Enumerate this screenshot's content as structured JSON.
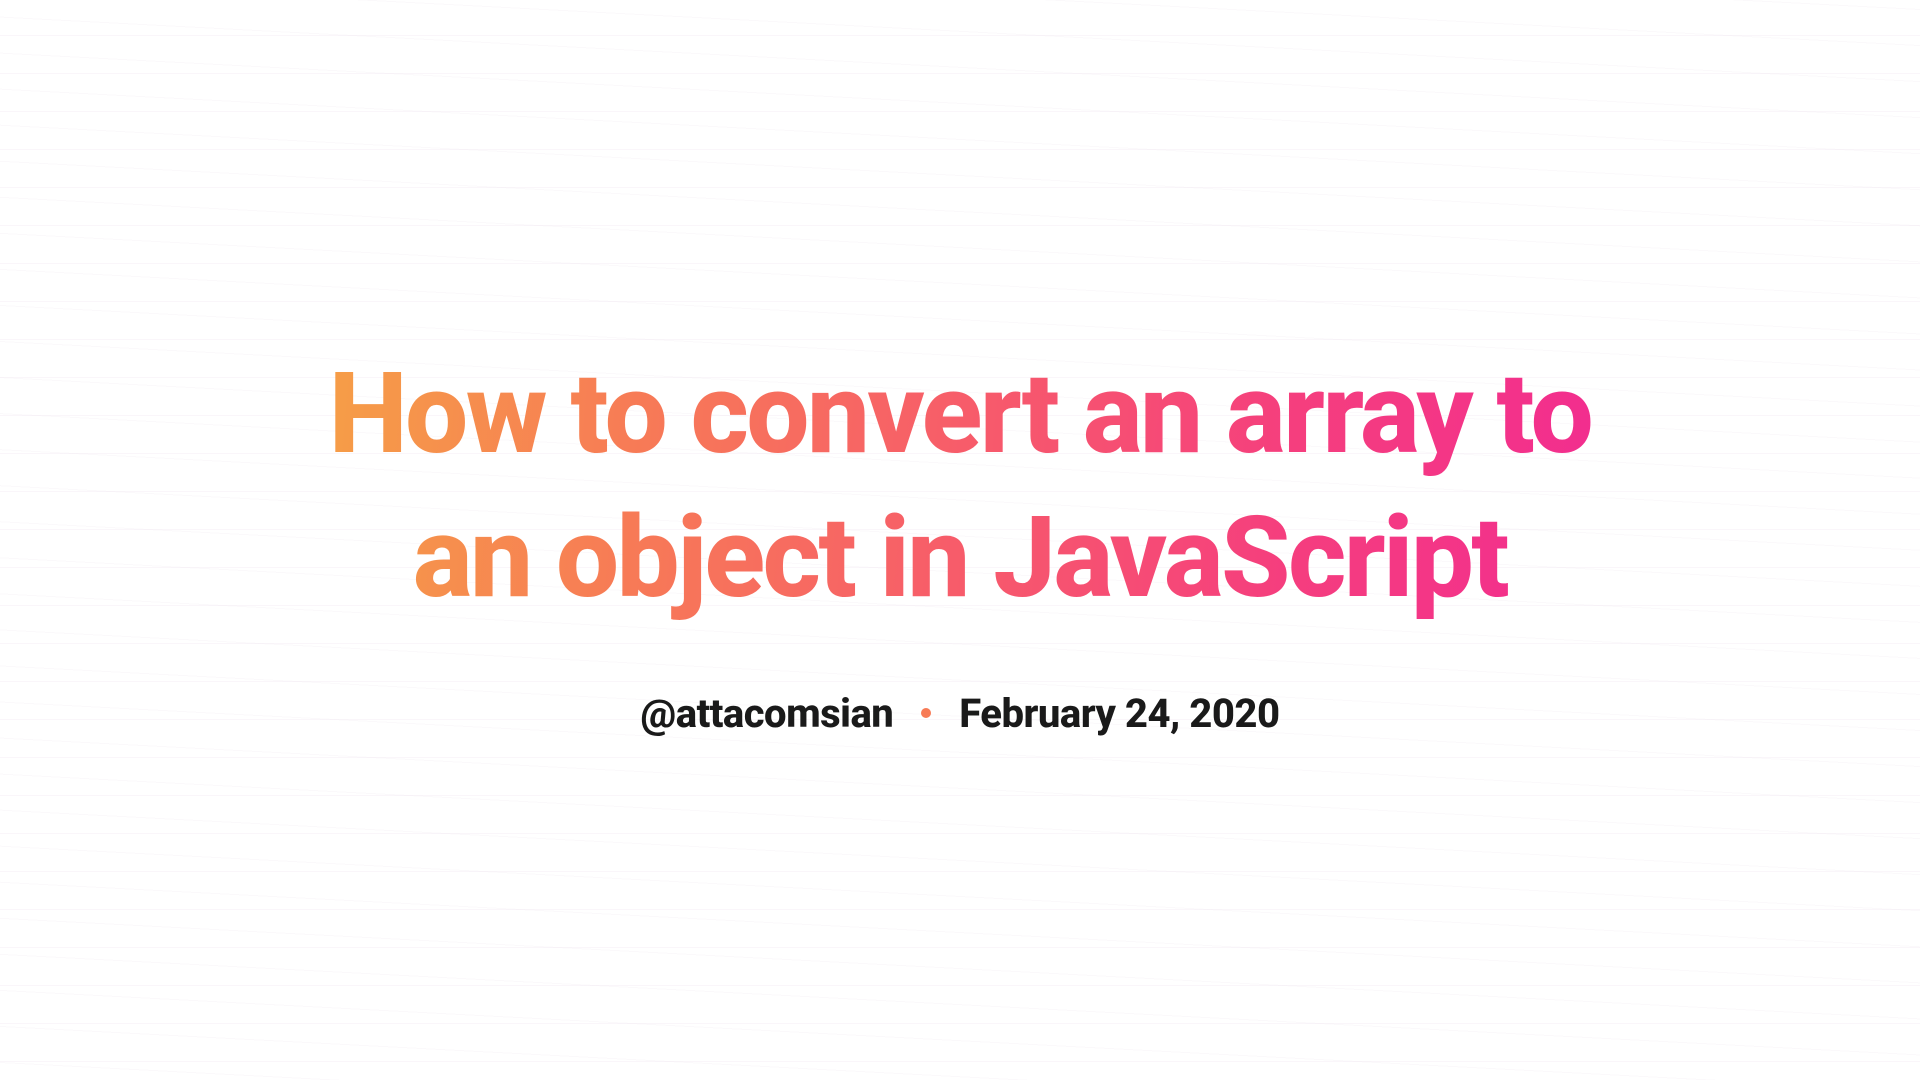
{
  "title": "How to convert an array to an object in JavaScript",
  "author_handle": "@attacomsian",
  "date": "February 24, 2020"
}
